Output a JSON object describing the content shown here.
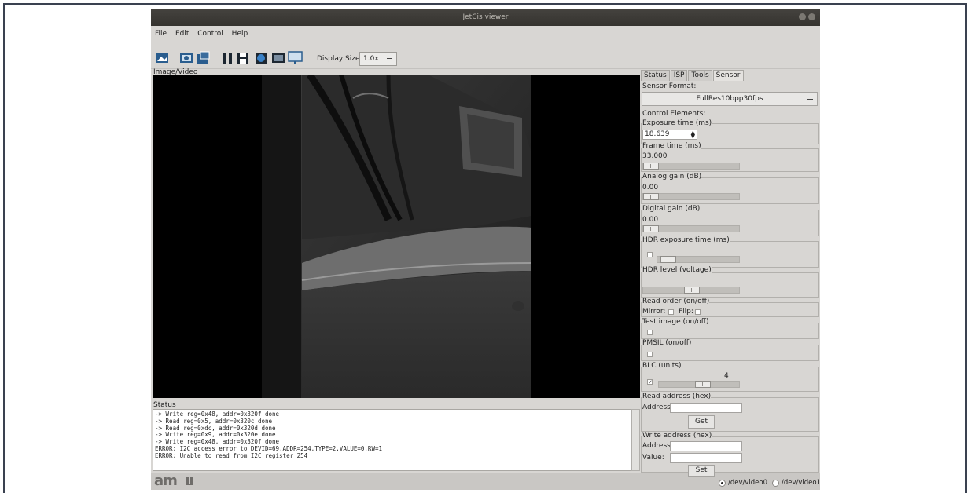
{
  "window": {
    "title": "JetCis viewer"
  },
  "menu": [
    "File",
    "Edit",
    "Control",
    "Help"
  ],
  "toolbar": {
    "icons": [
      "open-image-icon",
      "camera-icon",
      "open-folder-icon",
      "pause-icon",
      "save-icon",
      "record-icon",
      "snapshot-icon",
      "screen-icon"
    ],
    "display_size_label": "Display Size:",
    "display_size_value": "1.0x"
  },
  "image_panel": {
    "label": "Image/Video"
  },
  "status": {
    "label": "Status",
    "lines": [
      "-> Write reg=0x48, addr=0x320f done",
      "-> Read reg=0x5, addr=0x320c done",
      "-> Read reg=0xdc, addr=0x320d done",
      "-> Write reg=0x9, addr=0x320e done",
      "-> Write reg=0x48, addr=0x320f done",
      "ERROR: I2C access error to DEVID=69,ADDR=254,TYPE=2,VALUE=0,RW=1",
      "ERROR: Unable to read from I2C register 254"
    ]
  },
  "tabs": [
    "Status",
    "ISP",
    "Tools",
    "Sensor"
  ],
  "sensor": {
    "format_label": "Sensor Format:",
    "format_value": "FullRes10bpp30fps",
    "control_elements_label": "Control Elements:",
    "exposure_label": "Exposure time (ms)",
    "exposure_value": "18.639",
    "frame_label": "Frame time (ms)",
    "frame_value": "33.000",
    "analog_label": "Analog gain (dB)",
    "analog_value": "0.00",
    "digital_label": "Digital gain (dB)",
    "digital_value": "0.00",
    "hdr_exposure_label": "HDR exposure time (ms)",
    "hdr_level_label": "HDR level (voltage)",
    "read_order_label": "Read order (on/off)",
    "mirror_label": "Mirror:",
    "flip_label": "Flip:",
    "test_image_label": "Test image (on/off)",
    "pmsil_label": "PMSIL (on/off)",
    "blc_label": "BLC (units)",
    "blc_value": "4",
    "blc_checked": true,
    "read_address_label": "Read address (hex)",
    "address_label": "Address:",
    "get_button": "Get",
    "write_address_label": "Write address (hex)",
    "write_addr_label": "Address:",
    "value_label": "Value:",
    "set_button": "Set"
  },
  "footer": {
    "logo": "ams",
    "video_options": [
      "/dev/video0",
      "/dev/video1"
    ],
    "selected_video": "/dev/video0"
  }
}
